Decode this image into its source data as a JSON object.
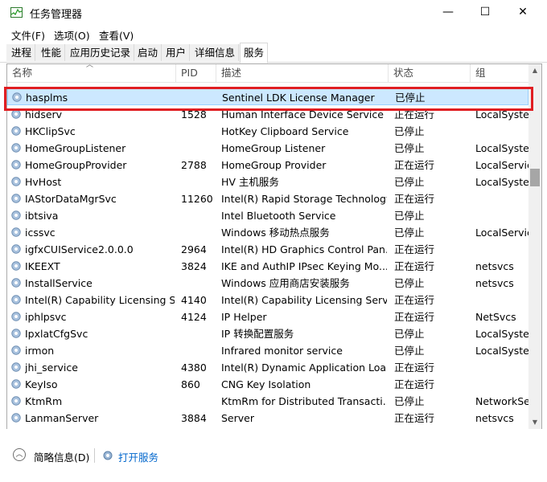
{
  "window": {
    "title": "任务管理器",
    "minimize": "—",
    "maximize": "☐",
    "close": "✕"
  },
  "menu": [
    "文件(F)",
    "选项(O)",
    "查看(V)"
  ],
  "tabs": [
    "进程",
    "性能",
    "应用历史记录",
    "启动",
    "用户",
    "详细信息",
    "服务"
  ],
  "columns": [
    "名称",
    "PID",
    "描述",
    "状态",
    "组"
  ],
  "rows": [
    {
      "name": "hasplms",
      "pid": "",
      "desc": "Sentinel LDK License Manager",
      "status": "已停止",
      "group": ""
    },
    {
      "name": "hidserv",
      "pid": "1528",
      "desc": "Human Interface Device Service",
      "status": "正在运行",
      "group": "LocalSystem"
    },
    {
      "name": "HKClipSvc",
      "pid": "",
      "desc": "HotKey Clipboard Service",
      "status": "已停止",
      "group": ""
    },
    {
      "name": "HomeGroupListener",
      "pid": "",
      "desc": "HomeGroup Listener",
      "status": "已停止",
      "group": "LocalSystem"
    },
    {
      "name": "HomeGroupProvider",
      "pid": "2788",
      "desc": "HomeGroup Provider",
      "status": "正在运行",
      "group": "LocalService"
    },
    {
      "name": "HvHost",
      "pid": "",
      "desc": "HV 主机服务",
      "status": "已停止",
      "group": "LocalSystem"
    },
    {
      "name": "IAStorDataMgrSvc",
      "pid": "11260",
      "desc": "Intel(R) Rapid Storage Technology",
      "status": "正在运行",
      "group": ""
    },
    {
      "name": "ibtsiva",
      "pid": "",
      "desc": "Intel Bluetooth Service",
      "status": "已停止",
      "group": ""
    },
    {
      "name": "icssvc",
      "pid": "",
      "desc": "Windows 移动热点服务",
      "status": "已停止",
      "group": "LocalService"
    },
    {
      "name": "igfxCUIService2.0.0.0",
      "pid": "2964",
      "desc": "Intel(R) HD Graphics Control Pan...",
      "status": "正在运行",
      "group": ""
    },
    {
      "name": "IKEEXT",
      "pid": "3824",
      "desc": "IKE and AuthIP IPsec Keying Mo...",
      "status": "正在运行",
      "group": "netsvcs"
    },
    {
      "name": "InstallService",
      "pid": "",
      "desc": "Windows 应用商店安装服务",
      "status": "已停止",
      "group": "netsvcs"
    },
    {
      "name": "Intel(R) Capability Licensing S...",
      "pid": "4140",
      "desc": "Intel(R) Capability Licensing Servi...",
      "status": "正在运行",
      "group": ""
    },
    {
      "name": "iphlpsvc",
      "pid": "4124",
      "desc": "IP Helper",
      "status": "正在运行",
      "group": "NetSvcs"
    },
    {
      "name": "IpxlatCfgSvc",
      "pid": "",
      "desc": "IP 转换配置服务",
      "status": "已停止",
      "group": "LocalSystem"
    },
    {
      "name": "irmon",
      "pid": "",
      "desc": "Infrared monitor service",
      "status": "已停止",
      "group": "LocalSystem"
    },
    {
      "name": "jhi_service",
      "pid": "4380",
      "desc": "Intel(R) Dynamic Application Loa...",
      "status": "正在运行",
      "group": ""
    },
    {
      "name": "KeyIso",
      "pid": "860",
      "desc": "CNG Key Isolation",
      "status": "正在运行",
      "group": ""
    },
    {
      "name": "KtmRm",
      "pid": "",
      "desc": "KtmRm for Distributed Transacti...",
      "status": "已停止",
      "group": "NetworkService"
    },
    {
      "name": "LanmanServer",
      "pid": "3884",
      "desc": "Server",
      "status": "正在运行",
      "group": "netsvcs"
    }
  ],
  "footer": {
    "fewer_details": "简略信息(D)",
    "open_services": "打开服务"
  },
  "colors": {
    "selection": "#cce8ff",
    "highlight_box": "#e01e22",
    "link": "#0066cc"
  }
}
